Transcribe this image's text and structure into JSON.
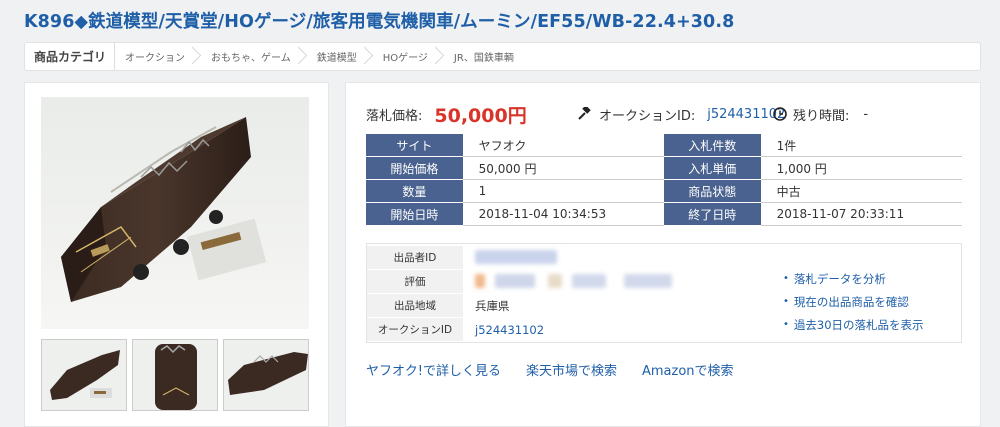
{
  "page": {
    "title": "K896◆鉄道模型/天賞堂/HOゲージ/旅客用電気機関車/ムーミン/EF55/WB-22.4+30.8"
  },
  "breadcrumb": {
    "head": "商品カテゴリ",
    "items": [
      "オークション",
      "おもちゃ、ゲーム",
      "鉄道模型",
      "HOゲージ",
      "JR、国鉄車輌"
    ]
  },
  "price": {
    "label": "落札価格:",
    "value": "50,000円",
    "auction_id_label": "オークションID:",
    "auction_id": "j524431102",
    "remaining_label": "残り時間:",
    "remaining_value": "-"
  },
  "info": {
    "rows": [
      {
        "h1": "サイト",
        "v1": "ヤフオク",
        "h2": "入札件数",
        "v2": "1件"
      },
      {
        "h1": "開始価格",
        "v1": "50,000 円",
        "h2": "入札単価",
        "v2": "1,000 円"
      },
      {
        "h1": "数量",
        "v1": "1",
        "h2": "商品状態",
        "v2": "中古"
      },
      {
        "h1": "開始日時",
        "v1": "2018-11-04 10:34:53",
        "h2": "終了日時",
        "v2": "2018-11-07 20:33:11"
      }
    ]
  },
  "seller": {
    "id_label": "出品者ID",
    "rating_label": "評価",
    "region_label": "出品地域",
    "region_value": "兵庫県",
    "auction_id_label": "オークションID",
    "auction_id_value": "j524431102",
    "links": [
      "落札データを分析",
      "現在の出品商品を確認",
      "過去30日の落札品を表示"
    ]
  },
  "bottom_links": [
    "ヤフオク!で詳しく見る",
    "楽天市場で検索",
    "Amazonで検索"
  ],
  "icons": {
    "auction_id": "gavel-icon",
    "remaining": "clock-icon"
  },
  "colors": {
    "title": "#1f5fa8",
    "price": "#d8342a",
    "table_header": "#4a628f",
    "link": "#1f5fa8"
  }
}
